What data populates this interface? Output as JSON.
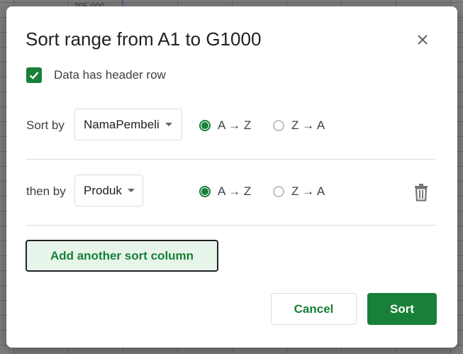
{
  "backdrop": {
    "cell_text": "795,000"
  },
  "dialog": {
    "title": "Sort range from A1 to G1000",
    "close_icon": "close-icon",
    "header_checkbox": {
      "label": "Data has header row",
      "checked": true
    },
    "sort_rows": [
      {
        "label": "Sort by",
        "column": "NamaPembeli",
        "asc_label": "A → Z",
        "desc_label": "Z → A",
        "selected": "asc"
      },
      {
        "label": "then by",
        "column": "Produk",
        "asc_label": "A → Z",
        "desc_label": "Z → A",
        "selected": "asc",
        "delete_icon": "trash-icon"
      }
    ],
    "add_column_label": "Add another sort column",
    "cancel_label": "Cancel",
    "sort_label": "Sort"
  },
  "colors": {
    "accent": "#188038",
    "accent_light": "#e6f4ea",
    "text": "#202124",
    "border": "#dadce0"
  }
}
